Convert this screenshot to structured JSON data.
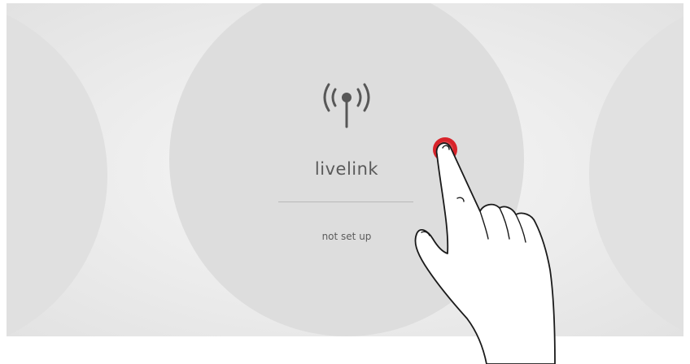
{
  "tiles": {
    "center": {
      "icon": "antenna-signal-icon",
      "title": "livelink",
      "status": "not set up"
    }
  },
  "overlay": {
    "icon": "hand-tap-pointer-icon",
    "tap_marker_color": "#d8232a"
  },
  "colors": {
    "tile": "#dddddd",
    "text": "#5a5a5a",
    "divider": "#b9b9b9",
    "background": "#eeeeee"
  }
}
